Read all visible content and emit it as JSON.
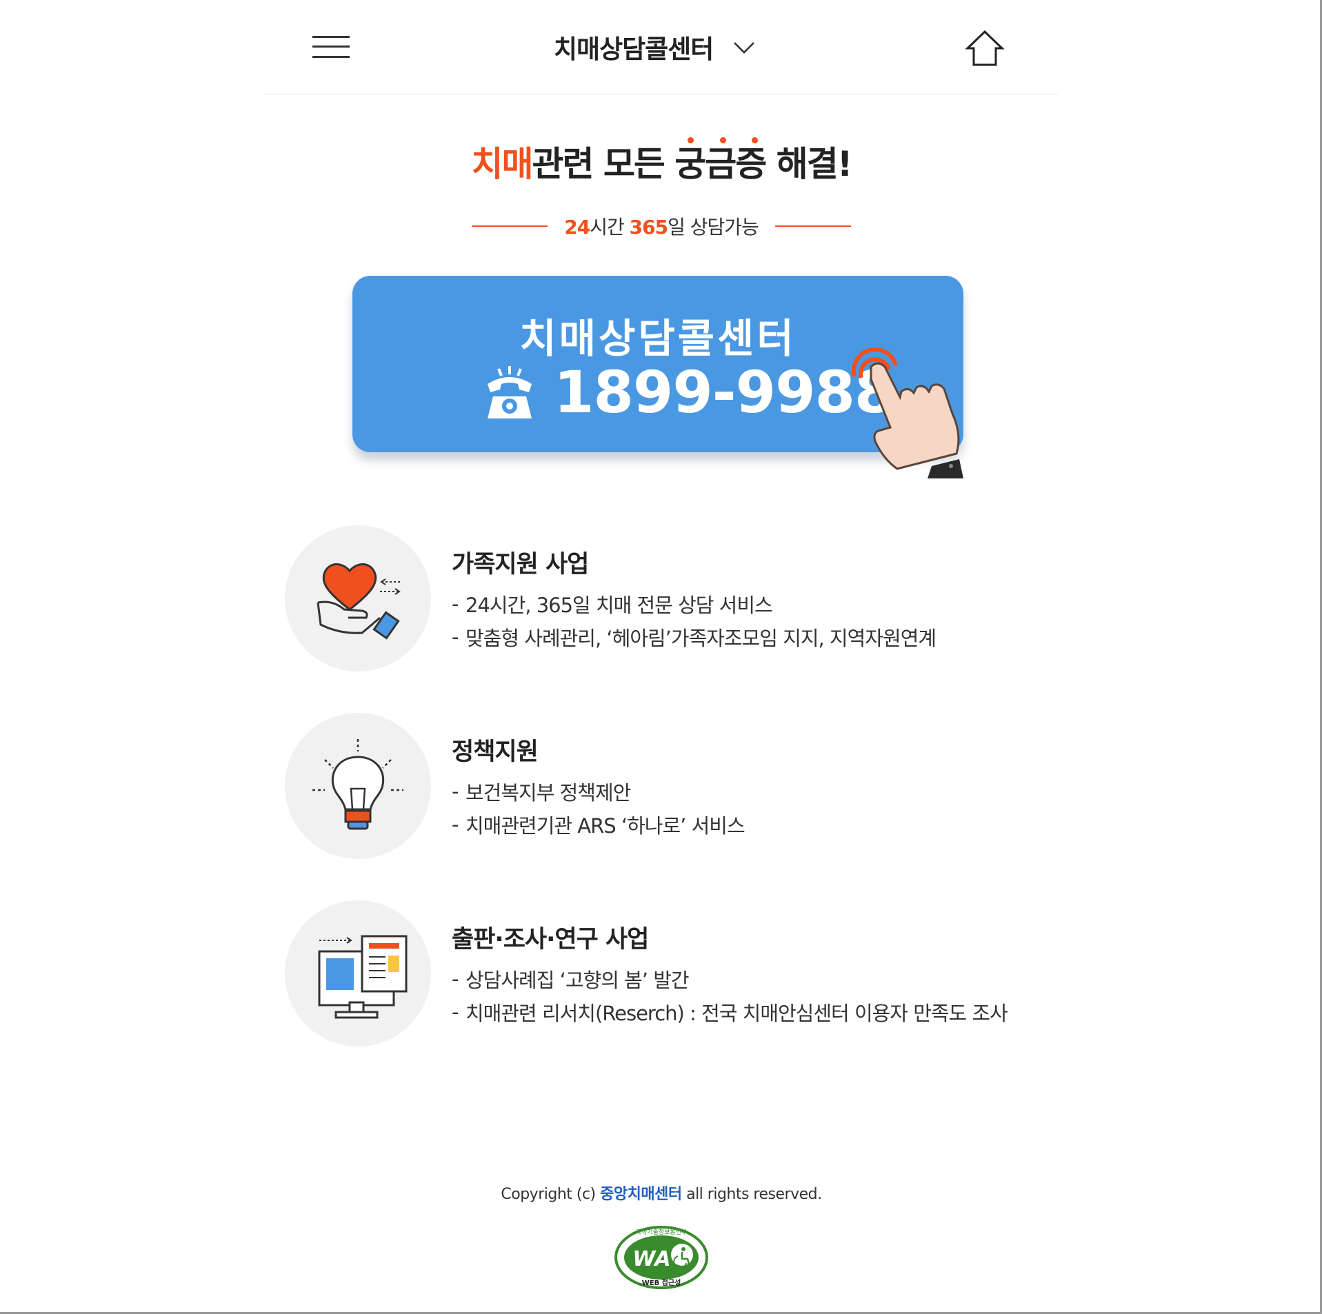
{
  "header": {
    "site_title": "치매상담콜센터",
    "menu_icon": "hamburger-menu-icon",
    "dropdown_icon": "chevron-down-icon",
    "home_icon": "home-icon"
  },
  "headline": {
    "highlight": "치매",
    "rest": "관련 모든 궁금증 해결!",
    "accent_color": "#f0501e"
  },
  "subline": {
    "hours": "24",
    "hours_unit": "시간 ",
    "days": "365",
    "days_unit": "일 상담가능"
  },
  "call_button": {
    "title": "치매상담콜센터",
    "phone_number": "1899-9988",
    "phone_icon": "telephone-icon",
    "hand_icon": "tap-hand-icon",
    "bg_color": "#4b98e2"
  },
  "services": [
    {
      "icon": "heart-hand-icon",
      "title": "가족지원 사업",
      "items": [
        "24시간, 365일 치매 전문 상담 서비스",
        "맞춤형 사례관리, ‘헤아림’가족자조모임 지지, 지역자원연계"
      ]
    },
    {
      "icon": "lightbulb-icon",
      "title": "정책지원",
      "items": [
        "보건복지부 정책제안",
        "치매관련기관 ARS ‘하나로’ 서비스"
      ]
    },
    {
      "icon": "monitor-document-icon",
      "title": "출판·조사·연구 사업",
      "items": [
        "상담사례집 ‘고향의 봄’ 발간",
        "치매관련 리서치(Reserch) : 전국 치매안심센터 이용자 만족도 조사"
      ]
    }
  ],
  "footer": {
    "copyright_prefix": "Copyright (c) ",
    "org_name": "중앙치매센터",
    "copyright_suffix": " all rights reserved.",
    "badge_icon": "web-accessibility-badge-icon",
    "badge_top_text": "과학기술정보통신부",
    "badge_logo_text": "WA",
    "badge_bottom_text": "WEB 접근성"
  }
}
